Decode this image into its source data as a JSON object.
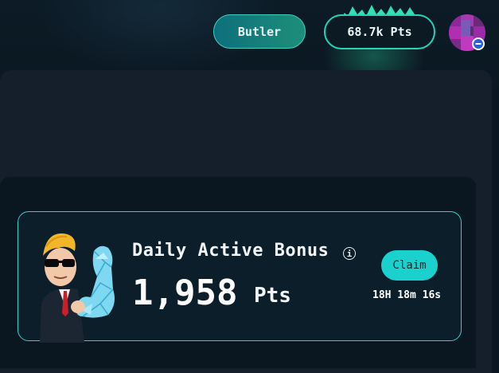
{
  "header": {
    "username_button": "Butler",
    "points_button": "68.7k Pts"
  },
  "bonus_card": {
    "title": "Daily Active Bonus",
    "value": "1,958",
    "unit": "Pts",
    "claim_label": "Claim",
    "countdown": "18H 18m 16s",
    "info_glyph": "i"
  },
  "colors": {
    "accent": "#2ed4c4",
    "claim_bg": "#1bd1cd",
    "butler_gradient_start": "#0e6f7c",
    "butler_gradient_end": "#1d8f7a",
    "background": "#0a1722"
  },
  "icons": {
    "avatar": "pixel-avatar",
    "avatar_badge": "minus-circle-icon",
    "info": "info-icon",
    "mascot": "wojak-mascot-flex"
  }
}
